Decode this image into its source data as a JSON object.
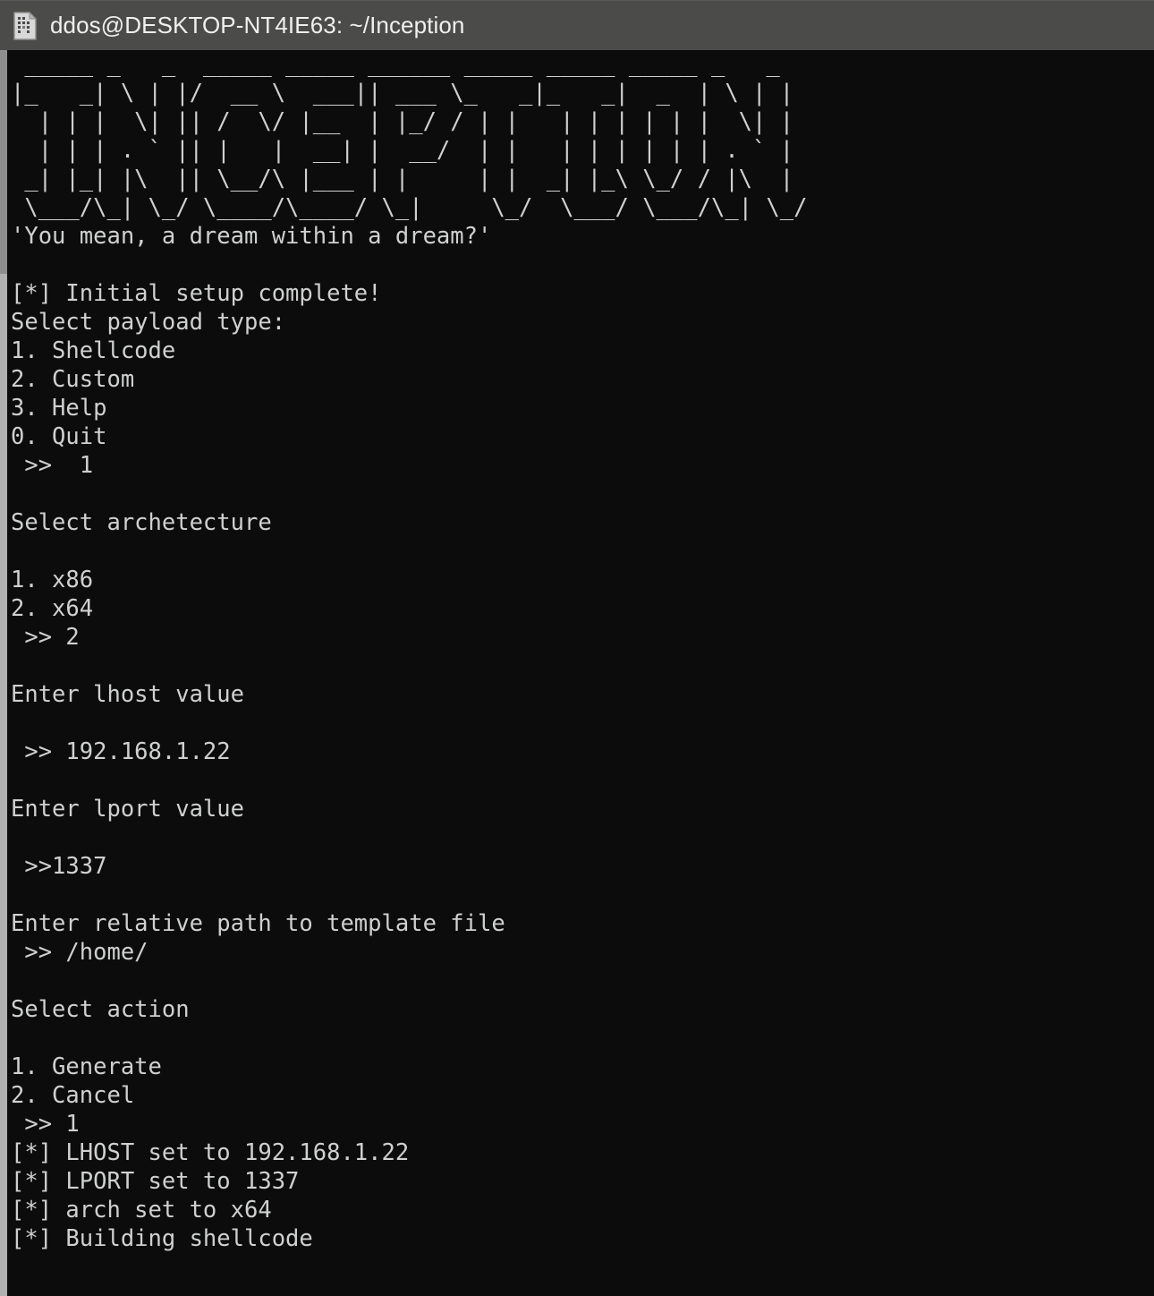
{
  "window": {
    "title": "ddos@DESKTOP-NT4IE63: ~/Inception",
    "icon": "file-document-icon",
    "titlebar_color": "#4b4b49",
    "background_color": "#0c0c0c",
    "foreground_color": "#cfd0d0",
    "accent_color": "#cc9a10"
  },
  "banner": {
    "name": "INCEPTION",
    "art": " _____ _   _  _____ _____ ______ _____ _____ _____ _   _\n|_   _| \\ | |/  __ \\  ___|| ___ \\_   _|_   _|  _  | \\ | |\n  | | |  \\| || /  \\/ |__  | |_/ / | |   | | | | | |  \\| |\n  | | | . ` || |   |  __| |  __/  | |   | | | | | | . ` |\n _| |_| |\\  || \\__/\\ |___ | |     | |  _| |_\\ \\_/ / |\\  |\n \\___/\\_| \\_/ \\____/\\____/ \\_|     \\_/  \\___/ \\___/\\_| \\_/"
  },
  "terminal": {
    "lines": [
      {
        "text": "'You mean, a dream within a dream?'",
        "color": "plain"
      },
      {
        "text": "",
        "color": "plain"
      },
      {
        "text": "[*] Initial setup complete!",
        "color": "plain"
      },
      {
        "text": "Select payload type:",
        "color": "plain"
      },
      {
        "text": "1. Shellcode",
        "color": "plain"
      },
      {
        "text": "2. Custom",
        "color": "plain"
      },
      {
        "text": "3. Help",
        "color": "plain"
      },
      {
        "text": "0. Quit",
        "color": "plain"
      },
      {
        "text": " >>  1",
        "color": "plain"
      },
      {
        "text": "",
        "color": "plain"
      },
      {
        "text": "Select archetecture",
        "color": "plain"
      },
      {
        "text": "",
        "color": "plain"
      },
      {
        "text": "1. x86",
        "color": "plain"
      },
      {
        "text": "2. x64",
        "color": "plain"
      },
      {
        "text": " >> 2",
        "color": "plain"
      },
      {
        "text": "",
        "color": "plain"
      },
      {
        "text": "Enter lhost value",
        "color": "plain"
      },
      {
        "text": "",
        "color": "plain"
      },
      {
        "text": " >> 192.168.1.22",
        "color": "plain"
      },
      {
        "text": "",
        "color": "plain"
      },
      {
        "text": "Enter lport value",
        "color": "plain"
      },
      {
        "text": "",
        "color": "plain"
      },
      {
        "text": " >>1337",
        "color": "plain"
      },
      {
        "text": "",
        "color": "plain"
      },
      {
        "text": "Enter relative path to template file",
        "color": "plain"
      },
      {
        "text": " >> /home/",
        "color": "plain"
      },
      {
        "text": "",
        "color": "plain"
      },
      {
        "text": "Select action",
        "color": "plain"
      },
      {
        "text": "",
        "color": "plain"
      },
      {
        "text": "1. Generate",
        "color": "plain"
      },
      {
        "text": "2. Cancel",
        "color": "plain"
      },
      {
        "text": " >> 1",
        "color": "plain"
      },
      {
        "text": "[*] LHOST set to 192.168.1.22",
        "color": "amber"
      },
      {
        "text": "[*] LPORT set to 1337",
        "color": "amber"
      },
      {
        "text": "[*] arch set to x64",
        "color": "amber"
      },
      {
        "text": "[*] Building shellcode",
        "color": "amber"
      }
    ]
  },
  "session": {
    "user": "ddos",
    "host": "DESKTOP-NT4IE63",
    "cwd": "~/Inception",
    "payload_type": "1",
    "payload_type_label": "Shellcode",
    "architecture_choice": "2",
    "architecture_label": "x64",
    "lhost": "192.168.1.22",
    "lport": "1337",
    "template_path": "/home/",
    "action_choice": "1",
    "action_label": "Generate"
  }
}
